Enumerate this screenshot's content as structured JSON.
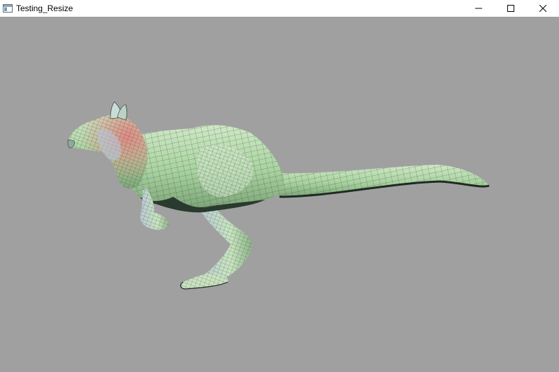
{
  "window": {
    "title": "Testing_Resize",
    "icon": "app-window-icon",
    "controls": {
      "minimize_icon": "minimize-icon",
      "maximize_icon": "maximize-icon",
      "close_icon": "close-icon"
    }
  },
  "viewport": {
    "background_color": "#a0a0a0",
    "model_color": "#b8dcb0",
    "model_highlight_color": "#d88c86",
    "model_shadow_color": "#2f3d33",
    "model_icon": "kangaroo-wireframe-mesh"
  }
}
